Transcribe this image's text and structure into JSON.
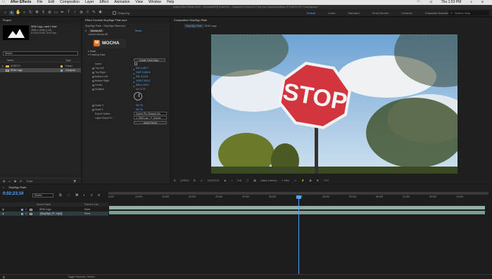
{
  "menubar": {
    "apple_icon": "apple-icon",
    "app": "After Effects",
    "items": [
      "File",
      "Edit",
      "Composition",
      "Layer",
      "Effect",
      "Animation",
      "View",
      "Window",
      "Help"
    ],
    "time": "Thu 1:53 PM"
  },
  "titlebar": "Adobe After Effects 2020 - /Volumes/BTB Drive/Dro... Content/03-Videos/10-Tips from Instructors/Mark VFX/AE/3-VFX Tracking.aep *",
  "toolbar": {
    "snapping": "Snapping",
    "workspaces": [
      "Default",
      "Learn",
      "Standard",
      "Small Screen",
      "Libraries",
      "Character Animation"
    ],
    "active_workspace": "Default",
    "search_placeholder": "Search Help"
  },
  "project": {
    "tab": "Project",
    "item_name": "SDM Logo",
    "item_used": ", used 1 time",
    "item_size": "2550 x 1098 (1.00)",
    "item_fps": "Δ 0;00;10;00, 29.97 fps",
    "search_placeholder": "Search",
    "columns": [
      "Name",
      "Type"
    ],
    "rows": [
      {
        "name": "ASSETS",
        "type": "Folder",
        "color": "#d8b34a"
      },
      {
        "name": "SDM Logo",
        "type": "Composi",
        "color": "#7a9bd6"
      }
    ],
    "bpc": "8 bpc"
  },
  "effects": {
    "tab": "Effect Controls StopSign Plate.mp4",
    "layer": "StopSign Plate · StopSign Plate.mp4",
    "effect_name": "Mocha AE",
    "reset": "Reset",
    "launch": "Launch Mocha AE",
    "logo_text": "MOCHA",
    "groups": [
      "Matte",
      "Tracking Data"
    ],
    "create_btn": "Create Track Data...",
    "invert_label": "Invert",
    "props": [
      {
        "k": "Top Left",
        "v": "551.5,287.7"
      },
      {
        "k": "Top Right",
        "v": "1087.2,469.5"
      },
      {
        "k": "Bottom Left",
        "v": "551.3,1113"
      },
      {
        "k": "Bottom Right",
        "v": "1039.7,643.2"
      },
      {
        "k": "Center",
        "v": "839.1,476.0"
      },
      {
        "k": "Rotation",
        "v": "0x+17.5°"
      }
    ],
    "scale_x_label": "Scale X",
    "scale_x": "95.7%",
    "scale_y_label": "Scale Y",
    "scale_y": "95.7%",
    "export_option_label": "Export Option",
    "export_option": "Corner Pin (Support Mo",
    "layer_export_label": "Layer Export To",
    "layer_export": "1. SDM Log",
    "layer_export_src": "Source",
    "apply_btn": "Apply Export"
  },
  "composition": {
    "tab": "Composition StopSign Plate",
    "subtabs": [
      "StopSign Plate",
      "SDM Logo"
    ],
    "sign_text": "STOP",
    "zoom": "(100%)",
    "timecode": "0;02;23;19",
    "resolution": "Full",
    "camera": "Active Camera",
    "views": "1 View",
    "offset": "+0.0"
  },
  "timeline": {
    "tab": "StopSign Plate",
    "timecode": "0;02;23;19",
    "search_placeholder": "Search",
    "col_source": "Source Name",
    "col_parent": "Parent & Link",
    "layers": [
      {
        "num": "1",
        "name": "SDM Logo",
        "parent": "None"
      },
      {
        "num": "2",
        "name": "[StopSign_Pl...mp4]",
        "parent": "None"
      }
    ],
    "ruler": [
      "0;02f",
      "10;00f",
      "15;00f",
      "20;00f",
      "25;00f",
      "30;00f",
      "35;00f",
      "40;00f",
      "45;00f",
      "50;00f",
      "55;00f",
      "01;00f",
      "05;00f",
      "10;00f"
    ],
    "toggle": "Toggle Switches / Modes"
  },
  "colors": {
    "accent": "#4da3ff",
    "track_bar": "#8fb0a4",
    "layer_bar": "#7e9c91"
  }
}
